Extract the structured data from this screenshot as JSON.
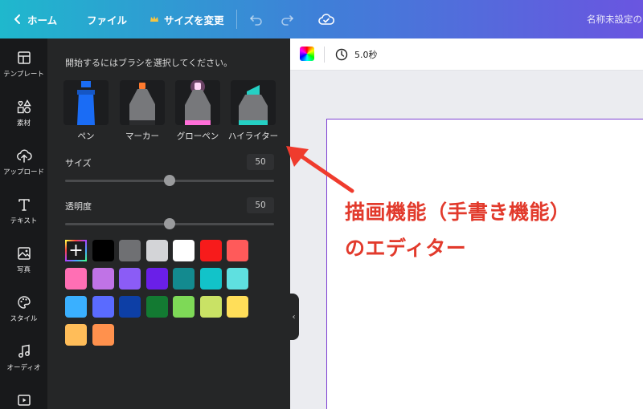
{
  "topbar": {
    "back_label": "ホーム",
    "file_label": "ファイル",
    "resize_label": "サイズを変更",
    "title": "名称未設定のデザイン"
  },
  "rail": {
    "items": [
      {
        "label": "テンプレート",
        "icon": "layout-icon"
      },
      {
        "label": "素材",
        "icon": "shapes-icon"
      },
      {
        "label": "アップロード",
        "icon": "cloud-upload-icon"
      },
      {
        "label": "テキスト",
        "icon": "text-icon"
      },
      {
        "label": "写真",
        "icon": "image-icon"
      },
      {
        "label": "スタイル",
        "icon": "palette-icon"
      },
      {
        "label": "オーディオ",
        "icon": "music-icon"
      },
      {
        "label": "動画",
        "icon": "video-icon"
      }
    ]
  },
  "panel": {
    "prompt": "開始するにはブラシを選択してください。",
    "brushes": [
      {
        "label": "ペン",
        "color": "#1a6cf5"
      },
      {
        "label": "マーカー",
        "color": "#ff7a2e"
      },
      {
        "label": "グローペン",
        "color": "#ff8ce8"
      },
      {
        "label": "ハイライター",
        "color": "#25d0c4"
      }
    ],
    "size": {
      "label": "サイズ",
      "value": "50",
      "fraction": 0.5
    },
    "opacity": {
      "label": "透明度",
      "value": "50",
      "fraction": 0.5
    },
    "swatches": [
      "#000000",
      "#6f7073",
      "#d3d4d7",
      "#ffffff",
      "#f71b1b",
      "#ff5a5a",
      "#ff6fb4",
      "#c073e6",
      "#8b5cf6",
      "#6a1fe8",
      "#138a8f",
      "#12c3c9",
      "#5fe0e0",
      "#3ab0ff",
      "#5a6bff",
      "#0d3fa6",
      "#137a32",
      "#7ed957",
      "#c9e265",
      "#ffde59",
      "#ffbd59",
      "#ff914d"
    ]
  },
  "canvas": {
    "timer": "5.0秒"
  },
  "annotation": {
    "line1": "描画機能（手書き機能）",
    "line2": "のエディター"
  }
}
